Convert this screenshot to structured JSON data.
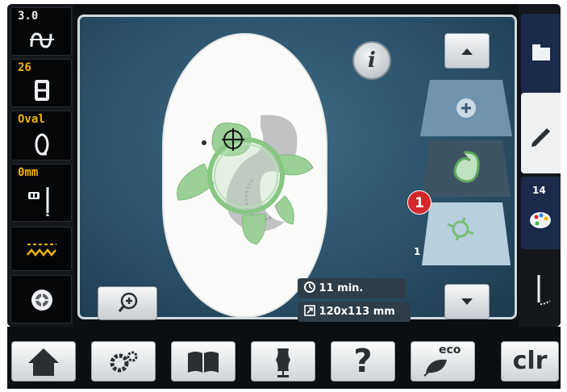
{
  "left_sidebar": {
    "stitch_width": "3.0",
    "stitch_length": "26",
    "hoop": "Oval",
    "offset": "0mm"
  },
  "main": {
    "info_label": "i",
    "time_label": "11 min.",
    "size_label": "120x113 mm",
    "marker_label": "1",
    "layer_number": "1"
  },
  "right_sidebar": {
    "color_count": "14"
  },
  "bottom_bar": {
    "eco_label": "eco",
    "clr_label": "clr",
    "help_label": "?"
  },
  "colors": {
    "accent_yellow": "#f2b400",
    "badge_red": "#d3282b",
    "screen_bg": "#2b5169",
    "turtle_green": "#8cc98a"
  }
}
